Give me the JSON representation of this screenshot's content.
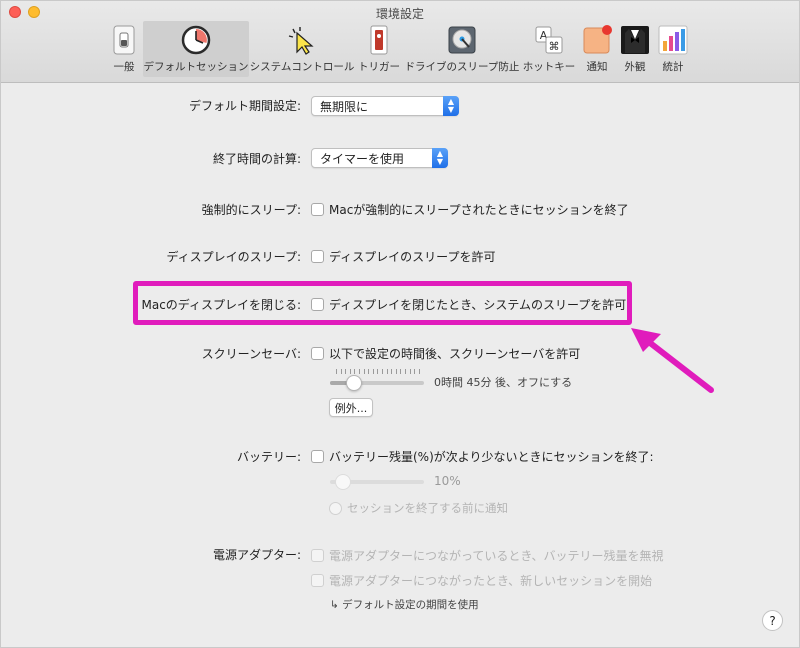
{
  "window": {
    "title": "環境設定"
  },
  "toolbar": {
    "items": [
      {
        "label": "一般",
        "icon": "switch-icon"
      },
      {
        "label": "デフォルトセッション",
        "icon": "clock-icon"
      },
      {
        "label": "システムコントロール",
        "icon": "cursor-icon"
      },
      {
        "label": "トリガー",
        "icon": "trigger-icon"
      },
      {
        "label": "ドライブのスリープ防止",
        "icon": "drive-icon"
      },
      {
        "label": "ホットキー",
        "icon": "hotkey-icon"
      },
      {
        "label": "通知",
        "icon": "notification-icon"
      },
      {
        "label": "外観",
        "icon": "appearance-icon"
      },
      {
        "label": "統計",
        "icon": "statistics-icon"
      }
    ],
    "selected_index": 1
  },
  "settings": {
    "default_period": {
      "label": "デフォルト期間設定:",
      "value": "無期限に"
    },
    "end_time_calc": {
      "label": "終了時間の計算:",
      "value": "タイマーを使用"
    },
    "forced_sleep": {
      "label": "強制的にスリープ:",
      "checkbox": "Macが強制的にスリープされたときにセッションを終了"
    },
    "display_sleep": {
      "label": "ディスプレイのスリープ:",
      "checkbox": "ディスプレイのスリープを許可"
    },
    "close_display": {
      "label": "Macのディスプレイを閉じる:",
      "checkbox": "ディスプレイを閉じたとき、システムのスリープを許可"
    },
    "screensaver": {
      "label": "スクリーンセーバ:",
      "checkbox": "以下で設定の時間後、スクリーンセーバを許可",
      "slider_text": "0時間 45分 後、オフにする",
      "exceptions_button": "例外..."
    },
    "battery": {
      "label": "バッテリー:",
      "checkbox": "バッテリー残量(%)が次より少ないときにセッションを終了:",
      "slider_value": "10%",
      "notify_checkbox": "セッションを終了する前に通知"
    },
    "power_adapter": {
      "label": "電源アダプター:",
      "checkbox1": "電源アダプターにつながっているとき、バッテリー残量を無視",
      "checkbox2": "電源アダプターにつながったとき、新しいセッションを開始",
      "note": "↳ デフォルト設定の期間を使用"
    }
  },
  "help_label": "?",
  "colors": {
    "highlight": "#e01cbc",
    "accent": "#1f6fe8"
  }
}
